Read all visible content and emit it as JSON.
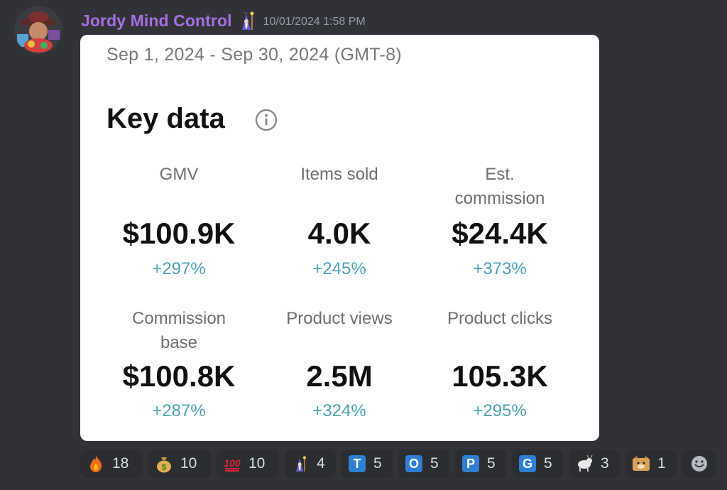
{
  "message": {
    "author": "Jordy Mind Control",
    "timestamp": "10/01/2024 1:58 PM",
    "author_badge_icon": "wizard-icon"
  },
  "card": {
    "date_range": "Sep 1, 2024 - Sep 30, 2024 (GMT-8)",
    "title": "Key data",
    "metrics": [
      {
        "label": "GMV",
        "value": "$100.9K",
        "change": "+297%"
      },
      {
        "label": "Items sold",
        "value": "4.0K",
        "change": "+245%"
      },
      {
        "label": "Est. commission",
        "value": "$24.4K",
        "change": "+373%"
      },
      {
        "label": "Commission base",
        "value": "$100.8K",
        "change": "+287%"
      },
      {
        "label": "Product views",
        "value": "2.5M",
        "change": "+324%"
      },
      {
        "label": "Product clicks",
        "value": "105.3K",
        "change": "+295%"
      }
    ],
    "change_color": "#4aa1b5"
  },
  "reactions": [
    {
      "icon": "fire-icon",
      "count": "18"
    },
    {
      "icon": "money-bag-icon",
      "count": "10"
    },
    {
      "icon": "hundred-points-icon",
      "count": "10"
    },
    {
      "icon": "wizard-icon",
      "count": "4"
    },
    {
      "icon": "letter-t-icon",
      "letter": "T",
      "count": "5"
    },
    {
      "icon": "letter-o-icon",
      "letter": "O",
      "count": "5"
    },
    {
      "icon": "letter-p-icon",
      "letter": "P",
      "count": "5"
    },
    {
      "icon": "letter-g-icon",
      "letter": "G",
      "count": "5"
    },
    {
      "icon": "goat-icon",
      "count": "3"
    },
    {
      "icon": "doge-icon",
      "count": "1"
    }
  ],
  "add_reaction_icon": "smiley-add-icon",
  "colors": {
    "background": "#313338",
    "username": "#a570e0",
    "reaction_bg": "#2b2d31",
    "letter_box": "#2f7fd2"
  }
}
